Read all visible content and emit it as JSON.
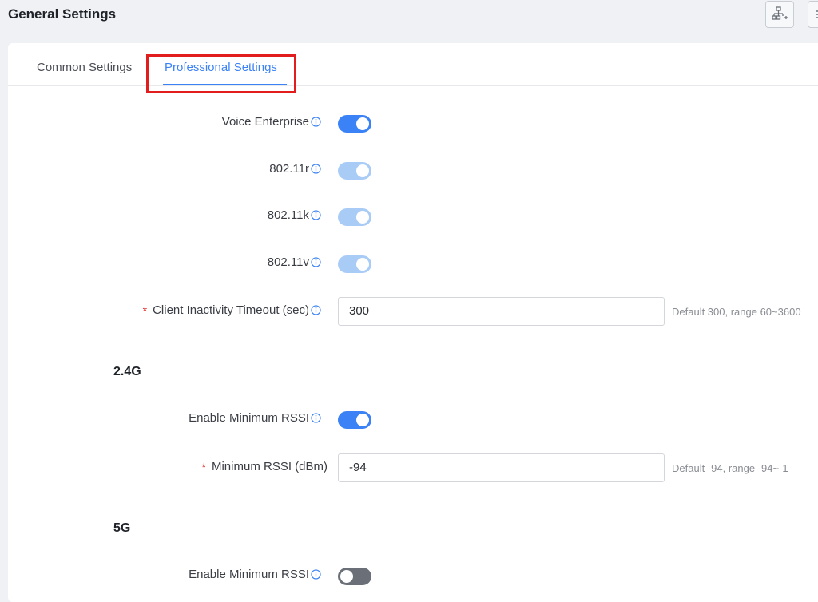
{
  "page": {
    "title": "General Settings"
  },
  "toolbar": {
    "button1_icon": "network-add-icon",
    "button2_icon": "menu-icon"
  },
  "tabs": [
    {
      "label": "Common Settings",
      "active": false
    },
    {
      "label": "Professional Settings",
      "active": true
    }
  ],
  "colors": {
    "accent": "#3b82f6",
    "highlight": "#e11d1d",
    "required": "#e03131"
  },
  "settings": {
    "voice_enterprise": {
      "label": "Voice Enterprise",
      "enabled": true
    },
    "dot11r": {
      "label": "802.11r",
      "enabled": true,
      "disabled": true
    },
    "dot11k": {
      "label": "802.11k",
      "enabled": true,
      "disabled": true
    },
    "dot11v": {
      "label": "802.11v",
      "enabled": true,
      "disabled": true
    },
    "client_timeout": {
      "label": "Client Inactivity Timeout (sec)",
      "required_mark": "*",
      "value": "300",
      "hint": "Default 300, range 60~3600"
    }
  },
  "band_24": {
    "title": "2.4G",
    "enable_min_rssi": {
      "label": "Enable Minimum RSSI",
      "enabled": true
    },
    "min_rssi": {
      "label": "Minimum RSSI (dBm)",
      "required_mark": "*",
      "value": "-94",
      "hint": "Default -94, range -94~-1"
    }
  },
  "band_5": {
    "title": "5G",
    "enable_min_rssi": {
      "label": "Enable Minimum RSSI",
      "enabled": false
    }
  }
}
